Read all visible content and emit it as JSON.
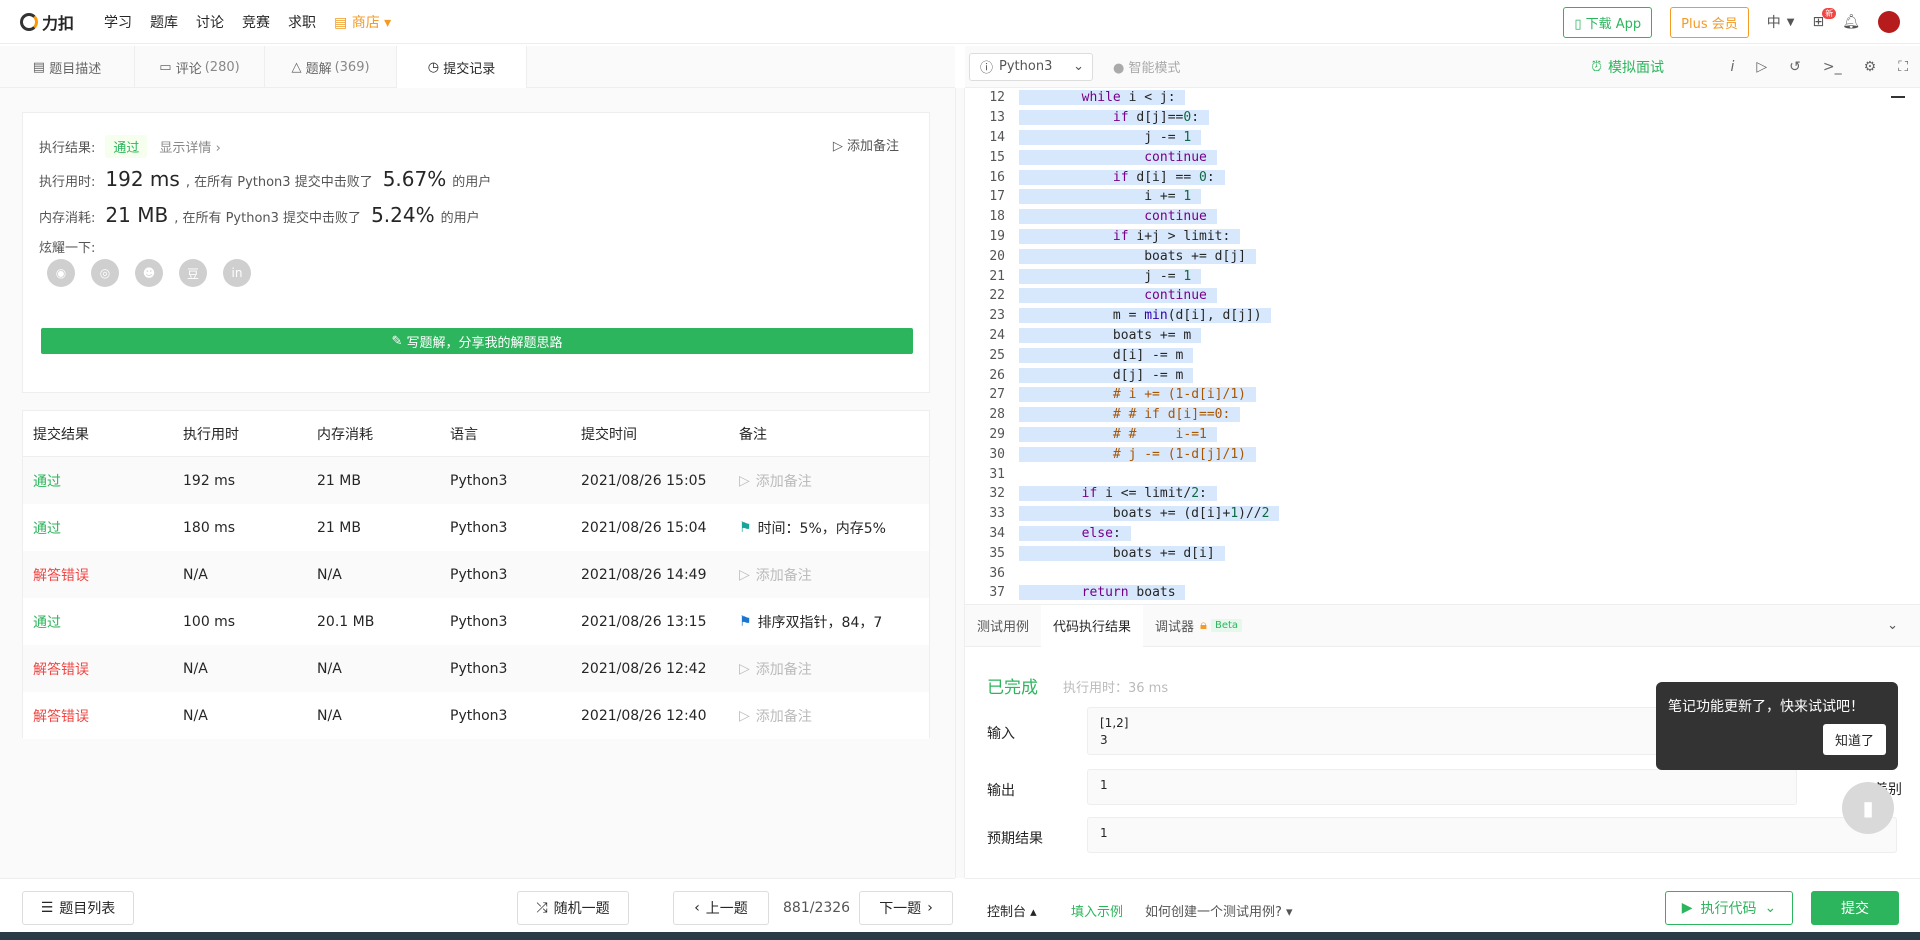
{
  "topnav": {
    "brand": "力扣",
    "links": [
      "学习",
      "题库",
      "讨论",
      "竞赛",
      "求职"
    ],
    "shop": "商店",
    "download": "下载 App",
    "plus": "Plus 会员",
    "lang": "中",
    "badge": "新"
  },
  "tabs": [
    {
      "label": "题目描述",
      "count": ""
    },
    {
      "label": "评论",
      "count": "(280)"
    },
    {
      "label": "题解",
      "count": "(369)"
    },
    {
      "label": "提交记录",
      "count": ""
    }
  ],
  "result": {
    "label_result": "执行结果:",
    "status": "通过",
    "detail": "显示详情",
    "add_note": "添加备注",
    "label_time": "执行用时:",
    "time_value": "192 ms",
    "time_text": ", 在所有 Python3 提交中击败了",
    "time_pct": "5.67%",
    "time_suffix": "的用户",
    "label_mem": "内存消耗:",
    "mem_value": "21 MB",
    "mem_text": ", 在所有 Python3 提交中击败了",
    "mem_pct": "5.24%",
    "mem_suffix": "的用户",
    "share_label": "炫耀一下:",
    "share_icons": [
      "wechat-icon",
      "weibo-icon",
      "qq-icon",
      "douban-icon",
      "linkedin-icon"
    ],
    "write_btn": "写题解，分享我的解题思路"
  },
  "submissions": {
    "headers": [
      "提交结果",
      "执行用时",
      "内存消耗",
      "语言",
      "提交时间",
      "备注"
    ],
    "rows": [
      {
        "status": "通过",
        "ok": true,
        "time": "192 ms",
        "mem": "21 MB",
        "lang": "Python3",
        "when": "2021/08/26 15:05",
        "note": "添加备注",
        "has_note": false
      },
      {
        "status": "通过",
        "ok": true,
        "time": "180 ms",
        "mem": "21 MB",
        "lang": "Python3",
        "when": "2021/08/26 15:04",
        "note": "时间：5%，内存5%",
        "has_note": true
      },
      {
        "status": "解答错误",
        "ok": false,
        "time": "N/A",
        "mem": "N/A",
        "lang": "Python3",
        "when": "2021/08/26 14:49",
        "note": "添加备注",
        "has_note": false
      },
      {
        "status": "通过",
        "ok": true,
        "time": "100 ms",
        "mem": "20.1 MB",
        "lang": "Python3",
        "when": "2021/08/26 13:15",
        "note": "排序双指针，84，7",
        "has_note": true
      },
      {
        "status": "解答错误",
        "ok": false,
        "time": "N/A",
        "mem": "N/A",
        "lang": "Python3",
        "when": "2021/08/26 12:42",
        "note": "添加备注",
        "has_note": false
      },
      {
        "status": "解答错误",
        "ok": false,
        "time": "N/A",
        "mem": "N/A",
        "lang": "Python3",
        "when": "2021/08/26 12:40",
        "note": "添加备注",
        "has_note": false
      }
    ]
  },
  "bottom_left": {
    "list": "题目列表",
    "random": "随机一题",
    "prev": "上一题",
    "pager": "881/2326",
    "next": "下一题"
  },
  "editor": {
    "language": "Python3",
    "smart_mode": "智能模式",
    "mock": "模拟面试",
    "lines": [
      {
        "n": "12",
        "i": 2,
        "code": "while i < j:"
      },
      {
        "n": "13",
        "i": 3,
        "code": "if d[j]==0:"
      },
      {
        "n": "14",
        "i": 4,
        "code": "j -= 1"
      },
      {
        "n": "15",
        "i": 4,
        "code": "continue"
      },
      {
        "n": "16",
        "i": 3,
        "code": "if d[i] == 0:"
      },
      {
        "n": "17",
        "i": 4,
        "code": "i += 1"
      },
      {
        "n": "18",
        "i": 4,
        "code": "continue"
      },
      {
        "n": "19",
        "i": 3,
        "code": "if i+j > limit:"
      },
      {
        "n": "20",
        "i": 4,
        "code": "boats += d[j]"
      },
      {
        "n": "21",
        "i": 4,
        "code": "j -= 1"
      },
      {
        "n": "22",
        "i": 4,
        "code": "continue"
      },
      {
        "n": "23",
        "i": 3,
        "code": "m = min(d[i], d[j])"
      },
      {
        "n": "24",
        "i": 3,
        "code": "boats += m"
      },
      {
        "n": "25",
        "i": 3,
        "code": "d[i] -= m"
      },
      {
        "n": "26",
        "i": 3,
        "code": "d[j] -= m"
      },
      {
        "n": "27",
        "i": 3,
        "code": "# i += (1-d[i]/1)"
      },
      {
        "n": "28",
        "i": 3,
        "code": "# # if d[i]==0:"
      },
      {
        "n": "29",
        "i": 3,
        "code": "# #     i-=1"
      },
      {
        "n": "30",
        "i": 3,
        "code": "# j -= (1-d[j]/1)"
      },
      {
        "n": "31",
        "i": 0,
        "code": ""
      },
      {
        "n": "32",
        "i": 2,
        "code": "if i <= limit/2:"
      },
      {
        "n": "33",
        "i": 3,
        "code": "boats += (d[i]+1)//2"
      },
      {
        "n": "34",
        "i": 2,
        "code": "else:"
      },
      {
        "n": "35",
        "i": 3,
        "code": "boats += d[i]"
      },
      {
        "n": "36",
        "i": 0,
        "code": ""
      },
      {
        "n": "37",
        "i": 2,
        "code": "return boats"
      }
    ]
  },
  "console": {
    "tabs": [
      "测试用例",
      "代码执行结果",
      "调试器"
    ],
    "beta": "Beta",
    "done": "已完成",
    "runtime": "执行用时：36 ms",
    "input_label": "输入",
    "input_value": "[1,2]\n3",
    "output_label": "输出",
    "output_value": "1",
    "expected_label": "预期结果",
    "expected_value": "1",
    "diff": "差别"
  },
  "popover": {
    "text": "笔记功能更新了，快来试试吧！",
    "button": "知道了"
  },
  "bottom_right": {
    "console": "控制台",
    "fill_example": "填入示例",
    "how_to": "如何创建一个测试用例?",
    "run": "执行代码",
    "submit": "提交"
  },
  "colors": {
    "accent": "#2db55d",
    "error": "#ef4743",
    "selection": "#d7e8fc",
    "shop": "#f59a23"
  }
}
